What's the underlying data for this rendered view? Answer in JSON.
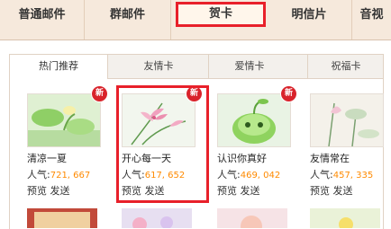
{
  "top_tabs": [
    {
      "label": "普通邮件"
    },
    {
      "label": "群邮件"
    },
    {
      "label": "贺卡"
    },
    {
      "label": "明信片"
    },
    {
      "label": "音视"
    }
  ],
  "sub_tabs": [
    {
      "label": "热门推荐"
    },
    {
      "label": "友情卡"
    },
    {
      "label": "爱情卡"
    },
    {
      "label": "祝福卡"
    }
  ],
  "badge_text": "新",
  "popularity_label": "人气:",
  "preview_label": "预览",
  "send_label": "发送",
  "cards": [
    {
      "name": "清凉一夏",
      "popularity": "721, 667",
      "is_new": true
    },
    {
      "name": "开心每一天",
      "popularity": "617, 652",
      "is_new": true
    },
    {
      "name": "认识你真好",
      "popularity": "469, 042",
      "is_new": true
    },
    {
      "name": "友情常在",
      "popularity": "457, 335",
      "is_new": false
    }
  ],
  "colors": {
    "accent_red": "#e8202a",
    "popularity_number": "#ff8a00",
    "badge": "#d9232b",
    "tab_bar": "#f6e9dc"
  }
}
